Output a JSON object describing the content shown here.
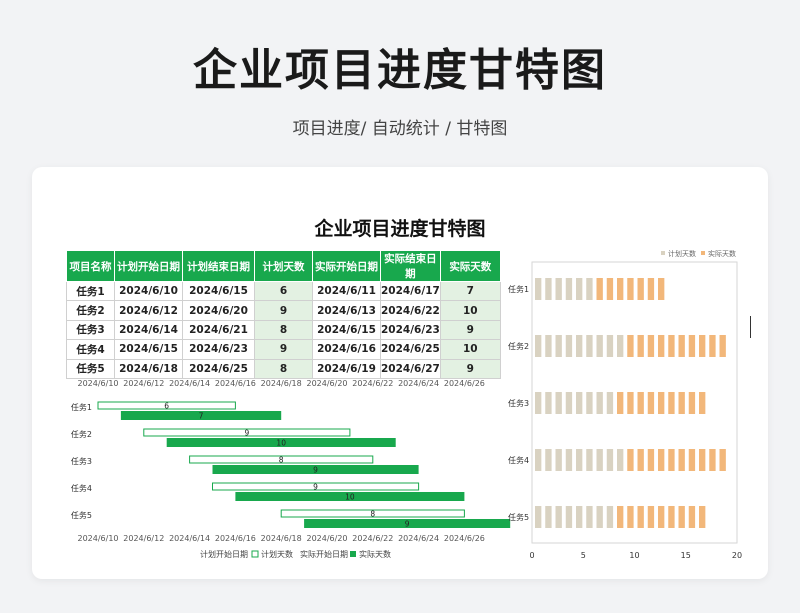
{
  "header": {
    "title": "企业项目进度甘特图",
    "subtitle": "项目进度/  自动统计  /  甘特图"
  },
  "sheet": {
    "title": "企业项目进度甘特图"
  },
  "table": {
    "headers": [
      "项目名称",
      "计划开始日期",
      "计划结束日期",
      "计划天数",
      "实际开始日期",
      "实际结束日期",
      "实际天数"
    ],
    "rows": [
      [
        "任务1",
        "2024/6/10",
        "2024/6/15",
        "6",
        "2024/6/11",
        "2024/6/17",
        "7"
      ],
      [
        "任务2",
        "2024/6/12",
        "2024/6/20",
        "9",
        "2024/6/13",
        "2024/6/22",
        "10"
      ],
      [
        "任务3",
        "2024/6/14",
        "2024/6/21",
        "8",
        "2024/6/15",
        "2024/6/23",
        "9"
      ],
      [
        "任务4",
        "2024/6/15",
        "2024/6/23",
        "9",
        "2024/6/16",
        "2024/6/25",
        "10"
      ],
      [
        "任务5",
        "2024/6/18",
        "2024/6/25",
        "8",
        "2024/6/19",
        "2024/6/27",
        "9"
      ]
    ]
  },
  "colors": {
    "green": "#18a84d",
    "plan_outline": "#18a84d",
    "beige": "#d9d2c1",
    "orange": "#f2b77a",
    "highlight": "#e3f1e2"
  },
  "chart_data": [
    {
      "type": "bar",
      "orientation": "horizontal-gantt",
      "categories": [
        "任务1",
        "任务2",
        "任务3",
        "任务4",
        "任务5"
      ],
      "x_tick_labels": [
        "2024/6/10",
        "2024/6/12",
        "2024/6/14",
        "2024/6/16",
        "2024/6/18",
        "2024/6/20",
        "2024/6/22",
        "2024/6/24",
        "2024/6/26"
      ],
      "xlim": [
        "2024/6/10",
        "2024/6/27"
      ],
      "series": [
        {
          "name": "计划开始日期",
          "values": [
            "2024/6/10",
            "2024/6/12",
            "2024/6/14",
            "2024/6/15",
            "2024/6/18"
          ]
        },
        {
          "name": "计划天数",
          "values": [
            6,
            9,
            8,
            9,
            8
          ]
        },
        {
          "name": "实际开始日期",
          "values": [
            "2024/6/11",
            "2024/6/13",
            "2024/6/15",
            "2024/6/16",
            "2024/6/19"
          ]
        },
        {
          "name": "实际天数",
          "values": [
            7,
            10,
            9,
            10,
            9
          ]
        }
      ],
      "legend": [
        "计划开始日期",
        "计划天数",
        "实际开始日期",
        "实际天数"
      ],
      "legend_position": "bottom"
    },
    {
      "type": "bar",
      "orientation": "horizontal-stacked",
      "categories": [
        "任务5",
        "任务4",
        "任务3",
        "任务2",
        "任务1"
      ],
      "series": [
        {
          "name": "计划天数",
          "values": [
            8,
            9,
            8,
            9,
            6
          ]
        },
        {
          "name": "实际天数",
          "values": [
            9,
            10,
            9,
            10,
            7
          ]
        }
      ],
      "x_tick_labels": [
        "0",
        "5",
        "10",
        "15",
        "20"
      ],
      "xlim": [
        0,
        20
      ],
      "legend_position": "top-right"
    }
  ]
}
